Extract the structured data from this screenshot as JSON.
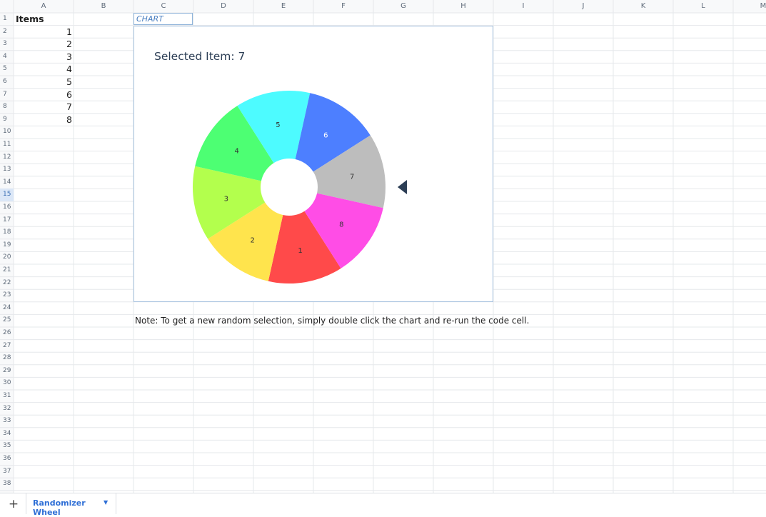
{
  "spreadsheet": {
    "columns": [
      "A",
      "B",
      "C",
      "D",
      "E",
      "F",
      "G",
      "H",
      "I",
      "J",
      "K",
      "L",
      "M"
    ],
    "rows": [
      "1",
      "2",
      "3",
      "4",
      "5",
      "6",
      "7",
      "8",
      "9",
      "10",
      "11",
      "12",
      "13",
      "14",
      "15",
      "16",
      "17",
      "18",
      "19",
      "20",
      "21",
      "22",
      "23",
      "24",
      "25",
      "26",
      "27",
      "28",
      "29",
      "30",
      "31",
      "32",
      "33",
      "34",
      "35",
      "36",
      "37",
      "38"
    ],
    "selected_row": "15",
    "header_cell": "Items",
    "items": [
      "1",
      "2",
      "3",
      "4",
      "5",
      "6",
      "7",
      "8"
    ],
    "chart_name": "CHART",
    "note": "Note: To get a new random selection, simply double click the chart and re-run the code cell."
  },
  "chart_data": {
    "type": "pie",
    "title": "Selected Item: 7",
    "donut": true,
    "slices": [
      {
        "label": "1",
        "value": 1,
        "color": "#ff4a4a"
      },
      {
        "label": "2",
        "value": 1,
        "color": "#ffe44d"
      },
      {
        "label": "3",
        "value": 1,
        "color": "#b3ff4d"
      },
      {
        "label": "4",
        "value": 1,
        "color": "#4dff73"
      },
      {
        "label": "5",
        "value": 1,
        "color": "#4dfbff"
      },
      {
        "label": "6",
        "value": 1,
        "color": "#4d7fff"
      },
      {
        "label": "7",
        "value": 1,
        "color": "#bdbdbd"
      },
      {
        "label": "8",
        "value": 1,
        "color": "#ff4de6"
      }
    ],
    "selected": "7",
    "pointer_color": "#2c3e55"
  },
  "sheet_tabs": [
    {
      "label": "Randomizer Wheel",
      "active": true
    }
  ],
  "colors": {
    "grid": "#e6e8eb",
    "header_text": "#5f6b7a",
    "accent": "#2f6fd6"
  },
  "icons": {
    "add_sheet": "plus-icon",
    "tab_menu": "caret-down-icon",
    "pointer": "triangle-pointer-icon"
  }
}
